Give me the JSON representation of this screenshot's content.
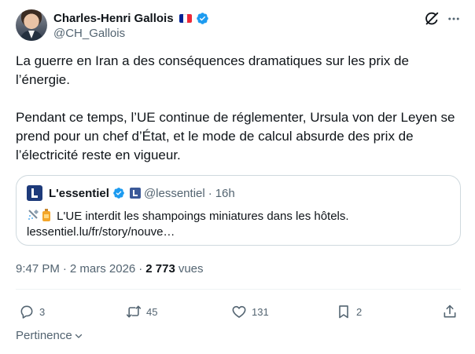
{
  "author": {
    "display_name": "Charles-Henri Gallois",
    "handle": "@CH_Gallois",
    "flag_colors": [
      "#002395",
      "#ffffff",
      "#ed2939"
    ]
  },
  "tweet": {
    "paragraph_1": "La guerre en Iran a des conséquences dramatiques sur les prix de l’énergie.",
    "paragraph_2": "Pendant ce temps, l’UE continue de réglementer, Ursula von der Leyen se prend pour un chef d’État, et le mode de calcul absurde des prix de l’électricité reste en vigueur."
  },
  "quote": {
    "name": "L'essentiel",
    "handle": "@lessentiel",
    "separator": "·",
    "time": "16h",
    "text": "L'UE interdit les shampoings miniatures dans les hôtels.",
    "link": "lessentiel.lu/fr/story/nouve…"
  },
  "meta": {
    "time": "9:47 PM",
    "separator_1": "·",
    "date": "2 mars 2026",
    "separator_2": "·",
    "views_count": "2 773",
    "views_label": "vues"
  },
  "actions": {
    "replies": "3",
    "reposts": "45",
    "likes": "131",
    "bookmarks": "2"
  },
  "footer": {
    "pertinence_label": "Pertinence"
  },
  "colors": {
    "verified_blue": "#1d9bf0",
    "text_secondary": "#536471",
    "border": "#cfd9de"
  },
  "icons": [
    "verified-icon",
    "grok-icon",
    "more-icon",
    "reply-icon",
    "repost-icon",
    "like-icon",
    "bookmark-icon",
    "share-icon",
    "chevron-down-icon"
  ]
}
